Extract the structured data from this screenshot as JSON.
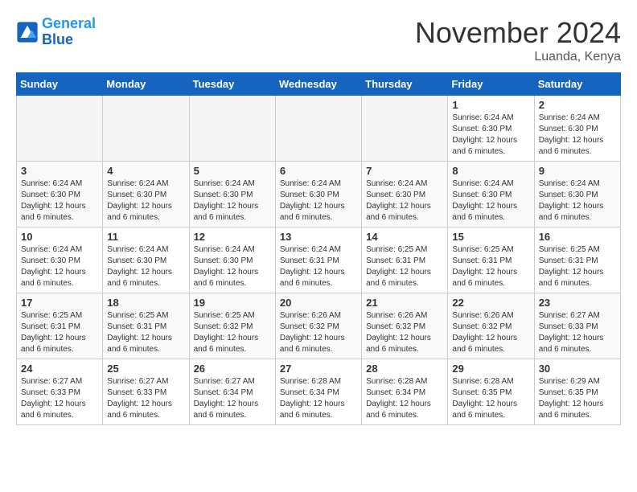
{
  "logo": {
    "line1": "General",
    "line2": "Blue"
  },
  "title": "November 2024",
  "location": "Luanda, Kenya",
  "days_header": [
    "Sunday",
    "Monday",
    "Tuesday",
    "Wednesday",
    "Thursday",
    "Friday",
    "Saturday"
  ],
  "weeks": [
    [
      {
        "day": "",
        "empty": true
      },
      {
        "day": "",
        "empty": true
      },
      {
        "day": "",
        "empty": true
      },
      {
        "day": "",
        "empty": true
      },
      {
        "day": "",
        "empty": true
      },
      {
        "day": "1",
        "sunrise": "6:24 AM",
        "sunset": "6:30 PM",
        "daylight": "12 hours and 6 minutes."
      },
      {
        "day": "2",
        "sunrise": "6:24 AM",
        "sunset": "6:30 PM",
        "daylight": "12 hours and 6 minutes."
      }
    ],
    [
      {
        "day": "3",
        "sunrise": "6:24 AM",
        "sunset": "6:30 PM",
        "daylight": "12 hours and 6 minutes."
      },
      {
        "day": "4",
        "sunrise": "6:24 AM",
        "sunset": "6:30 PM",
        "daylight": "12 hours and 6 minutes."
      },
      {
        "day": "5",
        "sunrise": "6:24 AM",
        "sunset": "6:30 PM",
        "daylight": "12 hours and 6 minutes."
      },
      {
        "day": "6",
        "sunrise": "6:24 AM",
        "sunset": "6:30 PM",
        "daylight": "12 hours and 6 minutes."
      },
      {
        "day": "7",
        "sunrise": "6:24 AM",
        "sunset": "6:30 PM",
        "daylight": "12 hours and 6 minutes."
      },
      {
        "day": "8",
        "sunrise": "6:24 AM",
        "sunset": "6:30 PM",
        "daylight": "12 hours and 6 minutes."
      },
      {
        "day": "9",
        "sunrise": "6:24 AM",
        "sunset": "6:30 PM",
        "daylight": "12 hours and 6 minutes."
      }
    ],
    [
      {
        "day": "10",
        "sunrise": "6:24 AM",
        "sunset": "6:30 PM",
        "daylight": "12 hours and 6 minutes."
      },
      {
        "day": "11",
        "sunrise": "6:24 AM",
        "sunset": "6:30 PM",
        "daylight": "12 hours and 6 minutes."
      },
      {
        "day": "12",
        "sunrise": "6:24 AM",
        "sunset": "6:30 PM",
        "daylight": "12 hours and 6 minutes."
      },
      {
        "day": "13",
        "sunrise": "6:24 AM",
        "sunset": "6:31 PM",
        "daylight": "12 hours and 6 minutes."
      },
      {
        "day": "14",
        "sunrise": "6:25 AM",
        "sunset": "6:31 PM",
        "daylight": "12 hours and 6 minutes."
      },
      {
        "day": "15",
        "sunrise": "6:25 AM",
        "sunset": "6:31 PM",
        "daylight": "12 hours and 6 minutes."
      },
      {
        "day": "16",
        "sunrise": "6:25 AM",
        "sunset": "6:31 PM",
        "daylight": "12 hours and 6 minutes."
      }
    ],
    [
      {
        "day": "17",
        "sunrise": "6:25 AM",
        "sunset": "6:31 PM",
        "daylight": "12 hours and 6 minutes."
      },
      {
        "day": "18",
        "sunrise": "6:25 AM",
        "sunset": "6:31 PM",
        "daylight": "12 hours and 6 minutes."
      },
      {
        "day": "19",
        "sunrise": "6:25 AM",
        "sunset": "6:32 PM",
        "daylight": "12 hours and 6 minutes."
      },
      {
        "day": "20",
        "sunrise": "6:26 AM",
        "sunset": "6:32 PM",
        "daylight": "12 hours and 6 minutes."
      },
      {
        "day": "21",
        "sunrise": "6:26 AM",
        "sunset": "6:32 PM",
        "daylight": "12 hours and 6 minutes."
      },
      {
        "day": "22",
        "sunrise": "6:26 AM",
        "sunset": "6:32 PM",
        "daylight": "12 hours and 6 minutes."
      },
      {
        "day": "23",
        "sunrise": "6:27 AM",
        "sunset": "6:33 PM",
        "daylight": "12 hours and 6 minutes."
      }
    ],
    [
      {
        "day": "24",
        "sunrise": "6:27 AM",
        "sunset": "6:33 PM",
        "daylight": "12 hours and 6 minutes."
      },
      {
        "day": "25",
        "sunrise": "6:27 AM",
        "sunset": "6:33 PM",
        "daylight": "12 hours and 6 minutes."
      },
      {
        "day": "26",
        "sunrise": "6:27 AM",
        "sunset": "6:34 PM",
        "daylight": "12 hours and 6 minutes."
      },
      {
        "day": "27",
        "sunrise": "6:28 AM",
        "sunset": "6:34 PM",
        "daylight": "12 hours and 6 minutes."
      },
      {
        "day": "28",
        "sunrise": "6:28 AM",
        "sunset": "6:34 PM",
        "daylight": "12 hours and 6 minutes."
      },
      {
        "day": "29",
        "sunrise": "6:28 AM",
        "sunset": "6:35 PM",
        "daylight": "12 hours and 6 minutes."
      },
      {
        "day": "30",
        "sunrise": "6:29 AM",
        "sunset": "6:35 PM",
        "daylight": "12 hours and 6 minutes."
      }
    ]
  ]
}
